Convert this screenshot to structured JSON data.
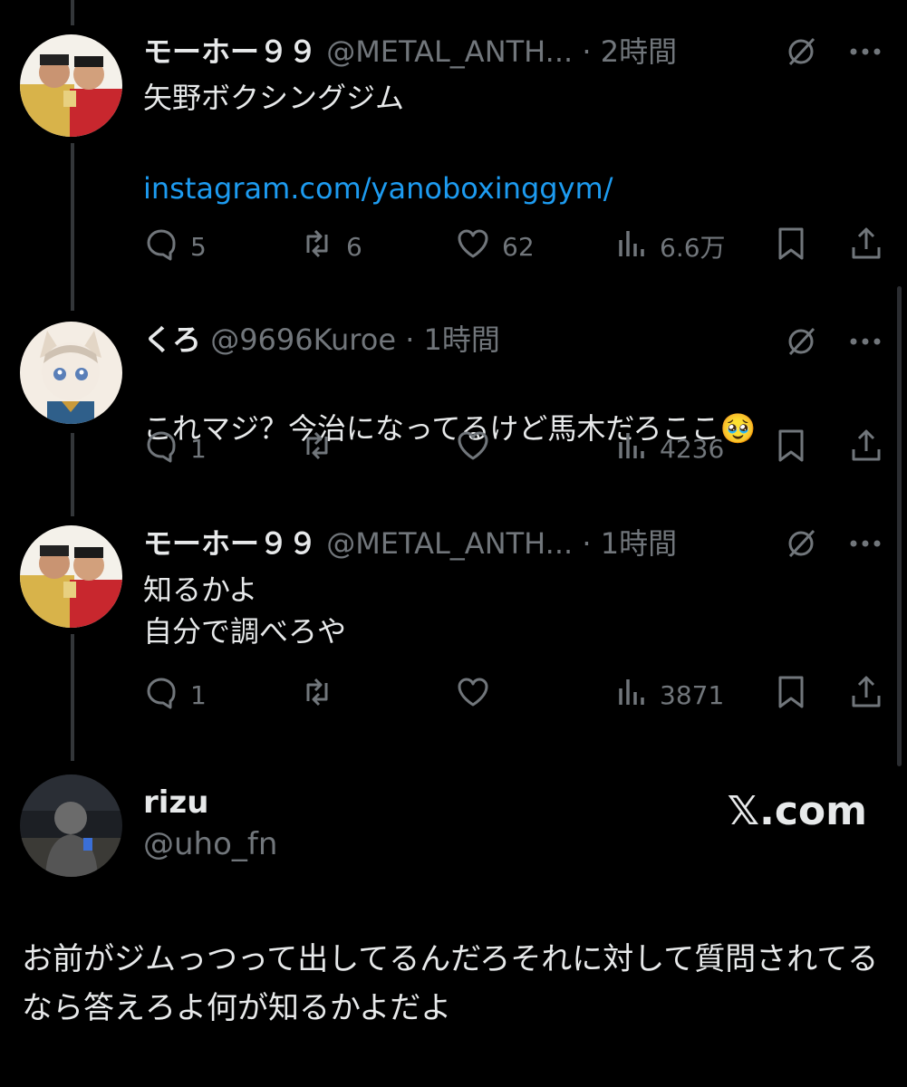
{
  "tweets": [
    {
      "name": "モーホー９９",
      "handle": "@METAL_ANTH...",
      "dot": "·",
      "time": "2時間",
      "text": "矢野ボクシングジム",
      "link": "instagram.com/yanoboxinggym/",
      "replies": "5",
      "retweets": "6",
      "likes": "62",
      "views": "6.6万"
    },
    {
      "name": "くろ",
      "handle": "@9696Kuroe",
      "dot": "·",
      "time": "1時間",
      "text": "これマジ？今治になってるけど馬木だろここ",
      "emoji": "🥹",
      "replies": "1",
      "retweets": "",
      "likes": "",
      "views": "4236"
    },
    {
      "name": "モーホー９９",
      "handle": "@METAL_ANTH...",
      "dot": "·",
      "time": "1時間",
      "text": "知るかよ\n自分で調べろや",
      "replies": "1",
      "retweets": "",
      "likes": "",
      "views": "3871"
    }
  ],
  "card": {
    "name": "rizu",
    "handle": "@uho_fn",
    "brand": "𝕏.com",
    "text": "お前がジムっつって出してるんだろそれに対して質問されてるなら答えろよ何が知るかよだよ"
  },
  "icons": [
    "reply-icon",
    "retweet-icon",
    "like-icon",
    "views-icon",
    "bookmark-icon",
    "share-icon",
    "grok-icon",
    "more-icon"
  ]
}
